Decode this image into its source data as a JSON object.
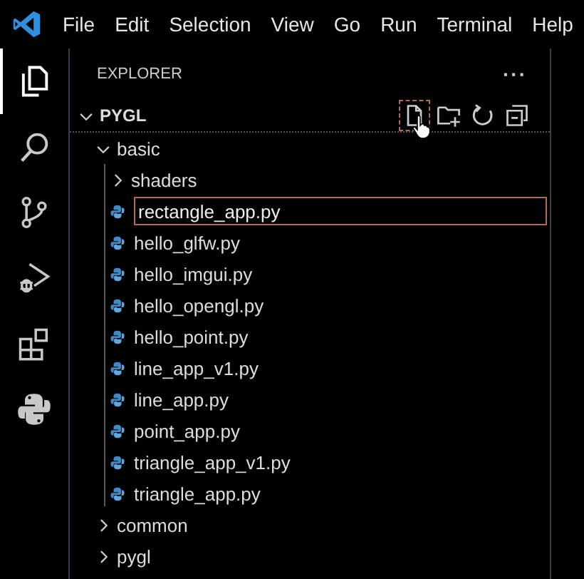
{
  "menu": [
    {
      "label": "File"
    },
    {
      "label": "Edit"
    },
    {
      "label": "Selection"
    },
    {
      "label": "View"
    },
    {
      "label": "Go"
    },
    {
      "label": "Run"
    },
    {
      "label": "Terminal"
    },
    {
      "label": "Help"
    }
  ],
  "activity_bar": [
    {
      "kind": "explorer",
      "selected": true
    },
    {
      "kind": "search",
      "selected": false
    },
    {
      "kind": "source-control",
      "selected": false
    },
    {
      "kind": "run-debug",
      "selected": false
    },
    {
      "kind": "extensions",
      "selected": false
    },
    {
      "kind": "python",
      "selected": false
    }
  ],
  "sidebar": {
    "title": "EXPLORER",
    "more": "···",
    "section": {
      "label": "PYGL",
      "expanded": true,
      "tree": [
        {
          "label": "basic",
          "kind": "folder",
          "expanded": true,
          "children": [
            {
              "label": "shaders",
              "kind": "folder",
              "expanded": false
            },
            {
              "label": "rectangle_app.py",
              "kind": "python",
              "editing": true
            },
            {
              "label": "hello_glfw.py",
              "kind": "python",
              "editing": false
            },
            {
              "label": "hello_imgui.py",
              "kind": "python",
              "editing": false
            },
            {
              "label": "hello_opengl.py",
              "kind": "python",
              "editing": false
            },
            {
              "label": "hello_point.py",
              "kind": "python",
              "editing": false
            },
            {
              "label": "line_app_v1.py",
              "kind": "python",
              "editing": false
            },
            {
              "label": "line_app.py",
              "kind": "python",
              "editing": false
            },
            {
              "label": "point_app.py",
              "kind": "python",
              "editing": false
            },
            {
              "label": "triangle_app_v1.py",
              "kind": "python",
              "editing": false
            },
            {
              "label": "triangle_app.py",
              "kind": "python",
              "editing": false
            }
          ]
        },
        {
          "label": "common",
          "kind": "folder",
          "expanded": false
        },
        {
          "label": "pygl",
          "kind": "folder",
          "expanded": false
        }
      ]
    }
  }
}
